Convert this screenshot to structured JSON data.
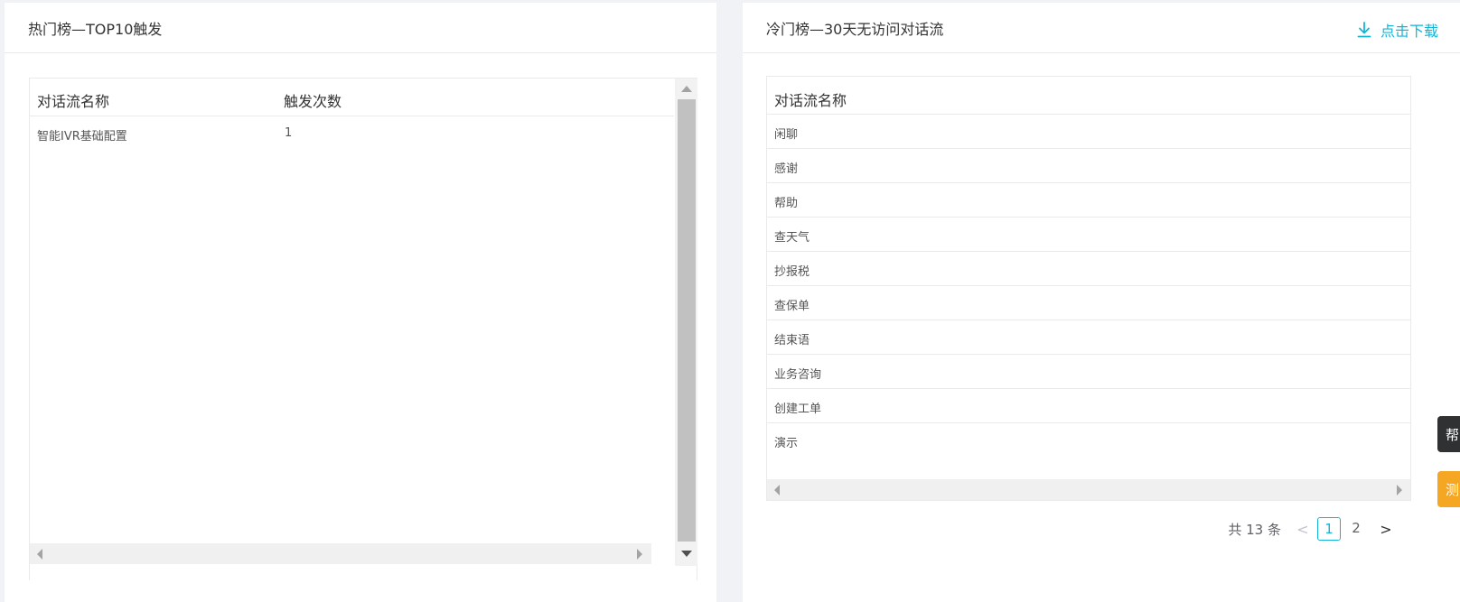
{
  "hot_panel": {
    "title": "热门榜—TOP10触发",
    "columns": [
      "对话流名称",
      "触发次数"
    ],
    "rows": [
      {
        "name": "智能IVR基础配置",
        "count": "1"
      }
    ]
  },
  "cold_panel": {
    "title": "冷门榜—30天无访问对话流",
    "download_label": "点击下载",
    "columns": [
      "对话流名称"
    ],
    "rows": [
      "闲聊",
      "感谢",
      "帮助",
      "查天气",
      "抄报税",
      "查保单",
      "结束语",
      "业务咨询",
      "创建工单",
      "演示"
    ]
  },
  "pagination": {
    "total_text": "共 13 条",
    "prev": "<",
    "pages": [
      "1",
      "2"
    ],
    "current": "1",
    "next": ">"
  },
  "side_tabs": {
    "help": "帮",
    "test": "测"
  },
  "colors": {
    "accent": "#13b5d6",
    "side_help_bg": "#303133",
    "side_test_bg": "#f5a623"
  }
}
